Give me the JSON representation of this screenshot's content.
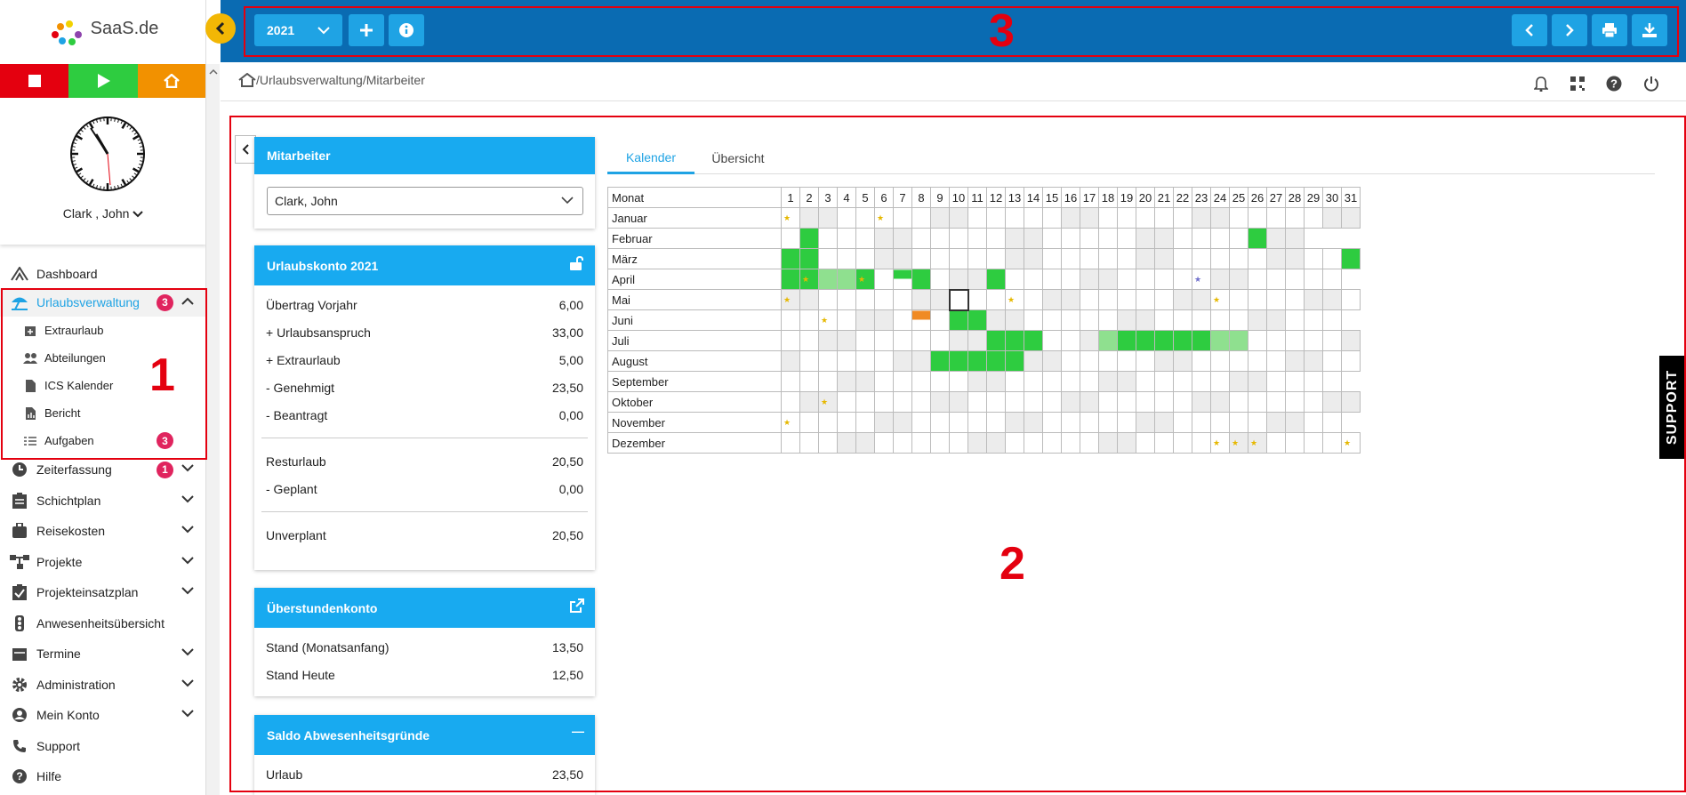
{
  "logo": {
    "text": "SaaS",
    "suffix": ".de"
  },
  "user": {
    "name": "Clark , John"
  },
  "topbar": {
    "year": "2021"
  },
  "breadcrumb": "/Urlaubsverwaltung/Mitarbeiter",
  "nav": {
    "dashboard": "Dashboard",
    "urlaubsverwaltung": "Urlaubsverwaltung",
    "urlaubsverwaltung_badge": "3",
    "sub": {
      "extraurlaub": "Extraurlaub",
      "abteilungen": "Abteilungen",
      "ics": "ICS Kalender",
      "bericht": "Bericht",
      "aufgaben": "Aufgaben",
      "aufgaben_badge": "3"
    },
    "zeiterfassung": "Zeiterfassung",
    "zeiterfassung_badge": "1",
    "schichtplan": "Schichtplan",
    "reisekosten": "Reisekosten",
    "projekte": "Projekte",
    "projekteinsatzplan": "Projekteinsatzplan",
    "anwesenheit": "Anwesenheitsübersicht",
    "termine": "Termine",
    "administration": "Administration",
    "meinkonto": "Mein Konto",
    "support": "Support",
    "hilfe": "Hilfe"
  },
  "annotations": {
    "n1": "1",
    "n2": "2",
    "n3": "3"
  },
  "mitarbeiter": {
    "title": "Mitarbeiter",
    "selected": "Clark, John"
  },
  "urlaubskonto": {
    "title": "Urlaubskonto 2021",
    "rows": [
      {
        "label": "Übertrag Vorjahr",
        "value": "6,00"
      },
      {
        "label": "+ Urlaubsanspruch",
        "value": "33,00"
      },
      {
        "label": "+ Extraurlaub",
        "value": "5,00"
      },
      {
        "label": "- Genehmigt",
        "value": "23,50"
      },
      {
        "label": "- Beantragt",
        "value": "0,00"
      }
    ],
    "rows2": [
      {
        "label": "Resturlaub",
        "value": "20,50"
      },
      {
        "label": "- Geplant",
        "value": "0,00"
      }
    ],
    "unplanned": {
      "label": "Unverplant",
      "value": "20,50"
    }
  },
  "ueberstunden": {
    "title": "Überstundenkonto",
    "rows": [
      {
        "label": "Stand (Monatsanfang)",
        "value": "13,50"
      },
      {
        "label": "Stand Heute",
        "value": "12,50"
      }
    ]
  },
  "saldo": {
    "title": "Saldo Abwesenheitsgründe",
    "collapse": "—",
    "rows": [
      {
        "label": "Urlaub",
        "value": "23,50"
      }
    ]
  },
  "tabs": {
    "calendar": "Kalender",
    "overview": "Übersicht"
  },
  "calendar": {
    "header": "Monat",
    "months": [
      "Januar",
      "Februar",
      "März",
      "April",
      "Mai",
      "Juni",
      "Juli",
      "August",
      "September",
      "Oktober",
      "November",
      "Dezember"
    ],
    "days_in_month": [
      31,
      28,
      31,
      30,
      31,
      30,
      31,
      31,
      30,
      31,
      30,
      31
    ],
    "weekends": [
      [
        2,
        3,
        9,
        10,
        16,
        17,
        23,
        24,
        30,
        31
      ],
      [
        6,
        7,
        13,
        14,
        20,
        21,
        27,
        28
      ],
      [
        6,
        7,
        13,
        14,
        20,
        21,
        27,
        28
      ],
      [
        3,
        4,
        10,
        11,
        17,
        18,
        24,
        25
      ],
      [
        1,
        2,
        8,
        9,
        15,
        16,
        22,
        23,
        29,
        30
      ],
      [
        5,
        6,
        12,
        13,
        19,
        20,
        26,
        27
      ],
      [
        3,
        4,
        10,
        11,
        17,
        18,
        24,
        25,
        31
      ],
      [
        1,
        7,
        8,
        14,
        15,
        21,
        22,
        28,
        29
      ],
      [
        4,
        5,
        11,
        12,
        18,
        19,
        25,
        26
      ],
      [
        2,
        3,
        9,
        10,
        16,
        17,
        23,
        24,
        30,
        31
      ],
      [
        6,
        7,
        13,
        14,
        20,
        21,
        27,
        28
      ],
      [
        4,
        5,
        11,
        12,
        18,
        19,
        25,
        26
      ]
    ],
    "vacation": [
      [],
      [
        2,
        26
      ],
      [
        1,
        2,
        31
      ],
      [
        1,
        2,
        5,
        8,
        12
      ],
      [],
      [
        10,
        11
      ],
      [
        12,
        13,
        14,
        19,
        20,
        21,
        22,
        23
      ],
      [
        9,
        10,
        11,
        12,
        13
      ],
      [],
      [],
      [],
      []
    ],
    "vacation_half": [
      [],
      [],
      [],
      [
        7
      ],
      [],
      [],
      [],
      [],
      [],
      [],
      [],
      []
    ],
    "vacation_light": [
      [],
      [],
      [],
      [
        3,
        4
      ],
      [],
      [],
      [
        18,
        24,
        25
      ],
      [],
      [],
      [],
      [],
      []
    ],
    "overtime_half": [
      [],
      [],
      [],
      [],
      [],
      [
        8
      ],
      [],
      [],
      [],
      [],
      [],
      []
    ],
    "holidays": [
      [
        1,
        6
      ],
      [],
      [],
      [
        2,
        5
      ],
      [
        1,
        13,
        24
      ],
      [
        3
      ],
      [],
      [],
      [],
      [
        3
      ],
      [
        1
      ],
      [
        24,
        25,
        26,
        31
      ]
    ],
    "holidays_blue": [
      [],
      [],
      [],
      [
        23
      ],
      [],
      [],
      [],
      [],
      [],
      [],
      [],
      []
    ],
    "today": {
      "month": 4,
      "day": 10
    }
  },
  "support_tab": "SUPPORT"
}
